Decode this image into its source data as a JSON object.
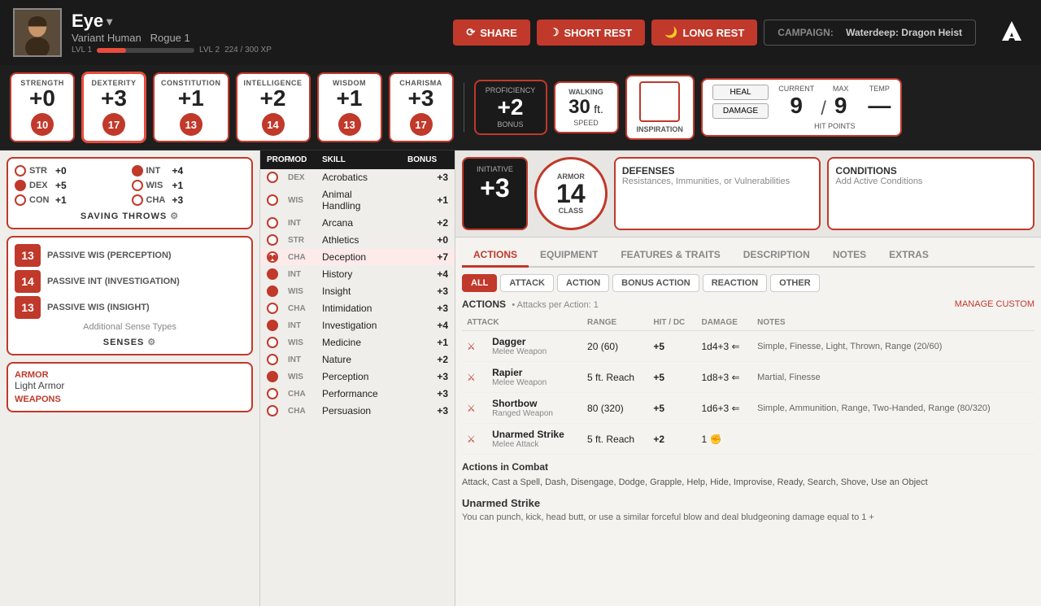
{
  "character": {
    "name": "Eye",
    "race": "Variant Human",
    "class": "Rogue 1",
    "xp_current": 224,
    "xp_max": 300,
    "level_current": 1,
    "level_next": 2
  },
  "header": {
    "share_label": "SHARE",
    "short_rest_label": "SHORT REST",
    "long_rest_label": "LONG REST",
    "campaign_label": "CAMPAIGN:",
    "campaign_name": "Waterdeep: Dragon Heist",
    "xp_text": "224 / 300 XP",
    "lvl1": "LVL 1",
    "lvl2": "LVL 2"
  },
  "stats": {
    "strength": {
      "label": "STRENGTH",
      "mod": "+0",
      "score": "10"
    },
    "dexterity": {
      "label": "DEXTERITY",
      "mod": "+3",
      "score": "17"
    },
    "constitution": {
      "label": "CONSTITUTION",
      "mod": "+1",
      "score": "13"
    },
    "intelligence": {
      "label": "INTELLIGENCE",
      "mod": "+2",
      "score": "14"
    },
    "wisdom": {
      "label": "WISDOM",
      "mod": "+1",
      "score": "13"
    },
    "charisma": {
      "label": "CHARISMA",
      "mod": "+3",
      "score": "17"
    }
  },
  "proficiency": {
    "label": "PROFICIENCY",
    "bonus": "+2",
    "sub": "BONUS"
  },
  "speed": {
    "label": "WALKING",
    "value": "30",
    "unit": "ft.",
    "sub": "SPEED"
  },
  "inspiration": {
    "label": "INSPIRATION"
  },
  "hp": {
    "heal_label": "HEAL",
    "damage_label": "DAMAGE",
    "current_label": "CURRENT",
    "max_label": "MAX",
    "temp_label": "TEMP",
    "current": "9",
    "max": "9",
    "temp": "—",
    "sub": "HIT POINTS"
  },
  "saving_throws": {
    "title": "SAVING THROWS",
    "items": [
      {
        "abbr": "STR",
        "mod": "+0",
        "proficient": false
      },
      {
        "abbr": "INT",
        "mod": "+4",
        "proficient": true
      },
      {
        "abbr": "DEX",
        "mod": "+5",
        "proficient": true
      },
      {
        "abbr": "WIS",
        "mod": "+1",
        "proficient": false
      },
      {
        "abbr": "CON",
        "mod": "+1",
        "proficient": false
      },
      {
        "abbr": "CHA",
        "mod": "+3",
        "proficient": false
      }
    ]
  },
  "passives": {
    "perception": {
      "score": "13",
      "label": "PASSIVE WIS (PERCEPTION)"
    },
    "investigation": {
      "score": "14",
      "label": "PASSIVE INT (INVESTIGATION)"
    },
    "insight": {
      "score": "13",
      "label": "PASSIVE WIS (INSIGHT)"
    },
    "senses_title": "SENSES",
    "senses_note": "Additional Sense Types"
  },
  "armor_equipment": {
    "armor_title": "ARMOR",
    "armor_value": "Light Armor",
    "weapons_title": "WEAPONS"
  },
  "skills_header": {
    "prof": "PROF",
    "mod": "MOD",
    "skill": "SKILL",
    "bonus": "BONUS"
  },
  "skills": [
    {
      "prof": false,
      "attr": "DEX",
      "name": "Acrobatics",
      "bonus": "+3"
    },
    {
      "prof": false,
      "attr": "WIS",
      "name": "Animal Handling",
      "bonus": "+1"
    },
    {
      "prof": false,
      "attr": "INT",
      "name": "Arcana",
      "bonus": "+2"
    },
    {
      "prof": false,
      "attr": "STR",
      "name": "Athletics",
      "bonus": "+0"
    },
    {
      "prof": true,
      "attr": "CHA",
      "name": "Deception",
      "bonus": "+7",
      "active": true
    },
    {
      "prof": true,
      "attr": "INT",
      "name": "History",
      "bonus": "+4"
    },
    {
      "prof": true,
      "attr": "WIS",
      "name": "Insight",
      "bonus": "+3"
    },
    {
      "prof": false,
      "attr": "CHA",
      "name": "Intimidation",
      "bonus": "+3"
    },
    {
      "prof": true,
      "attr": "INT",
      "name": "Investigation",
      "bonus": "+4"
    },
    {
      "prof": false,
      "attr": "WIS",
      "name": "Medicine",
      "bonus": "+1"
    },
    {
      "prof": false,
      "attr": "INT",
      "name": "Nature",
      "bonus": "+2"
    },
    {
      "prof": true,
      "attr": "WIS",
      "name": "Perception",
      "bonus": "+3"
    },
    {
      "prof": false,
      "attr": "CHA",
      "name": "Performance",
      "bonus": "+3"
    },
    {
      "prof": false,
      "attr": "CHA",
      "name": "Persuasion",
      "bonus": "+3"
    }
  ],
  "combat": {
    "initiative_label": "INITIATIVE",
    "initiative_value": "+3",
    "armor_label": "ARMOR",
    "armor_value": "14",
    "armor_sub": "CLASS",
    "defenses_title": "DEFENSES",
    "defenses_sub": "Resistances, Immunities, or Vulnerabilities",
    "conditions_title": "CONDITIONS",
    "conditions_sub": "Add Active Conditions"
  },
  "action_tabs": [
    {
      "label": "ACTIONS",
      "active": true
    },
    {
      "label": "EQUIPMENT",
      "active": false
    },
    {
      "label": "FEATURES & TRAITS",
      "active": false
    },
    {
      "label": "DESCRIPTION",
      "active": false
    },
    {
      "label": "NOTES",
      "active": false
    },
    {
      "label": "EXTRAS",
      "active": false
    }
  ],
  "filter_tabs": [
    {
      "label": "ALL",
      "active": true
    },
    {
      "label": "ATTACK",
      "active": false
    },
    {
      "label": "ACTION",
      "active": false
    },
    {
      "label": "BONUS ACTION",
      "active": false
    },
    {
      "label": "REACTION",
      "active": false
    },
    {
      "label": "OTHER",
      "active": false
    }
  ],
  "actions_section": {
    "title": "ACTIONS",
    "subtitle": "• Attacks per Action: 1",
    "manage_label": "MANAGE CUSTOM",
    "col_attack": "ATTACK",
    "col_range": "RANGE",
    "col_hit": "HIT / DC",
    "col_damage": "DAMAGE",
    "col_notes": "NOTES"
  },
  "weapons": [
    {
      "name": "Dagger",
      "sub": "Melee Weapon",
      "range": "20 (60)",
      "hit": "+5",
      "damage": "1d4+3 ⇐",
      "notes": "Simple, Finesse, Light, Thrown, Range (20/60)"
    },
    {
      "name": "Rapier",
      "sub": "Melee Weapon",
      "range": "5 ft. Reach",
      "hit": "+5",
      "damage": "1d8+3 ⇐",
      "notes": "Martial, Finesse"
    },
    {
      "name": "Shortbow",
      "sub": "Ranged Weapon",
      "range": "80 (320)",
      "hit": "+5",
      "damage": "1d6+3 ⇐",
      "notes": "Simple, Ammunition, Range, Two-Handed, Range (80/320)"
    },
    {
      "name": "Unarmed Strike",
      "sub": "Melee Attack",
      "range": "5 ft. Reach",
      "hit": "+2",
      "damage": "1 ✊",
      "notes": ""
    }
  ],
  "combat_actions": {
    "title": "Actions in Combat",
    "list": "Attack, Cast a Spell, Dash, Disengage, Dodge, Grapple, Help, Hide, Improvise, Ready, Search, Shove, Use an Object"
  },
  "unarmed_strike": {
    "title": "Unarmed Strike",
    "desc": "You can punch, kick, head butt, or use a similar forceful blow and deal bludgeoning damage equal to 1 +"
  }
}
